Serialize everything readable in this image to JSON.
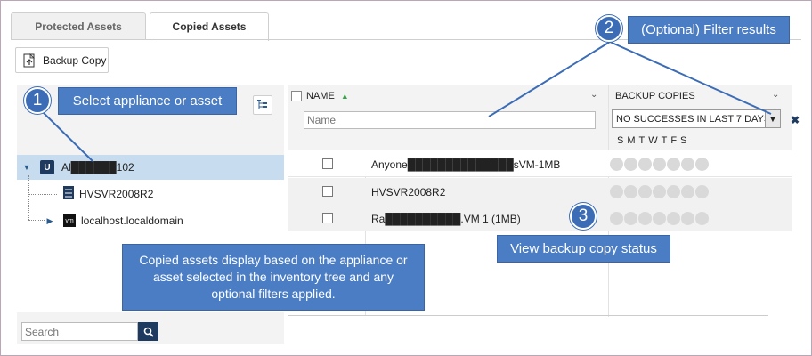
{
  "tabs": [
    {
      "label": "Protected Assets",
      "active": false
    },
    {
      "label": "Copied Assets",
      "active": true
    }
  ],
  "toolbar": {
    "backup_copy_label": "Backup Copy"
  },
  "inventory": {
    "items": [
      {
        "label": "Al██████102",
        "icon": "appliance-icon",
        "selected": true
      },
      {
        "label": "HVSVR2008R2",
        "icon": "server-icon"
      },
      {
        "label": "localhost.localdomain",
        "icon": "vmware-icon",
        "icon_text": "vm"
      }
    ],
    "search_placeholder": "Search"
  },
  "grid": {
    "name_header": "NAME",
    "name_filter_placeholder": "Name",
    "backup_header": "BACKUP COPIES",
    "backup_filter_value": "NO SUCCESSES IN LAST 7 DAYS",
    "days": "SMTWTFS",
    "rows": [
      {
        "name": "Anyone██████████████sVM-1MB",
        "status_count": 7
      },
      {
        "name": "HVSVR2008R2",
        "status_count": 7
      },
      {
        "name": "Ra██████████.VM 1 (1MB)",
        "status_count": 7
      }
    ]
  },
  "annotations": {
    "badge1": "1",
    "callout1": "Select appliance or asset",
    "badge2": "2",
    "callout2": "(Optional) Filter results",
    "badge3": "3",
    "callout3": "View backup copy status",
    "callout4": "Copied assets display based on the appliance or asset selected in the inventory tree and any optional filters applied."
  },
  "colors": {
    "accent": "#4a7dc4",
    "badge": "#3b6cb5",
    "selected_row": "#c7dcef",
    "search_button": "#1e3a5f",
    "status_dot": "#d9d9d9"
  }
}
